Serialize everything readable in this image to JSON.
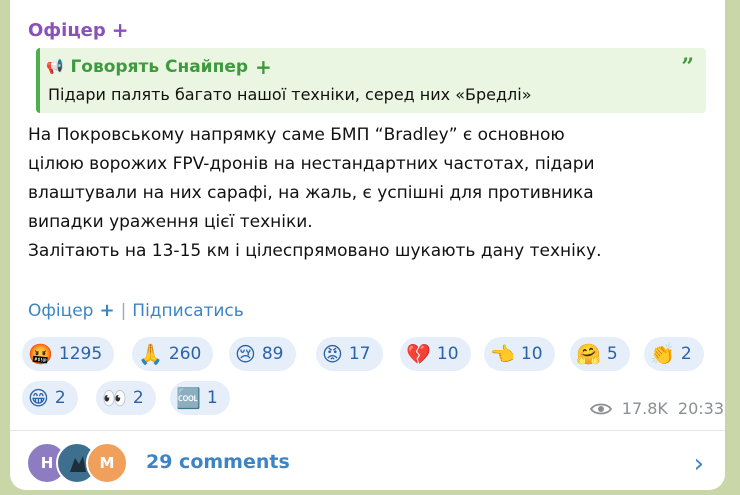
{
  "post": {
    "author": "Офіцер",
    "reply": {
      "source": "Говорять Снайпер",
      "text": "Підари палять багато нашої техніки, серед них «Бредлі»"
    },
    "body_lines": [
      "На Покровському напрямку саме БМП “Bradley” є основною",
      "цілюю ворожих FPV-дронів на нестандартних частотах, підари",
      "влаштували на них сарафі, на жаль, є успішні для противника",
      "випадки ураження цієї техніки.",
      "Залітають на 13-15 км і цілеспрямовано шукають дану техніку."
    ],
    "footer": {
      "channel": "Офіцер",
      "separator": "|",
      "subscribe": "Підписатись"
    },
    "reactions": [
      {
        "icon": "angry-swearing-face-icon",
        "emoji": "🤬",
        "count": "1295"
      },
      {
        "icon": "praying-hands-icon",
        "emoji": "🙏",
        "count": "260"
      },
      {
        "icon": "crying-face-icon",
        "emoji": "😢",
        "count": "89"
      },
      {
        "icon": "angry-face-icon",
        "emoji": "😡",
        "count": "17"
      },
      {
        "icon": "broken-heart-icon",
        "emoji": "💔",
        "count": "10"
      },
      {
        "icon": "pointing-hand-icon",
        "emoji": "👈",
        "count": "10"
      },
      {
        "icon": "hugging-face-icon",
        "emoji": "🤗",
        "count": "5"
      },
      {
        "icon": "clapping-hands-icon",
        "emoji": "👏",
        "count": "2"
      },
      {
        "icon": "grinning-face-icon",
        "emoji": "😁",
        "count": "2"
      },
      {
        "icon": "eyes-icon",
        "emoji": "👀",
        "count": "2"
      },
      {
        "icon": "cool-button-icon",
        "emoji": "🆒",
        "count": "1"
      }
    ],
    "views": "17.8K",
    "time": "20:33",
    "comments": {
      "label": "29 comments",
      "avatars": [
        {
          "letter": "Н",
          "color": "#8e7cc3"
        },
        {
          "letter": "",
          "color": "#3f6f8f"
        },
        {
          "letter": "М",
          "color": "#f0a05a"
        }
      ]
    }
  },
  "colors": {
    "author": "#8a52b9",
    "reply_accent": "#4fae4e",
    "link": "#3d84c5",
    "reaction_bg": "#e6eefa"
  }
}
